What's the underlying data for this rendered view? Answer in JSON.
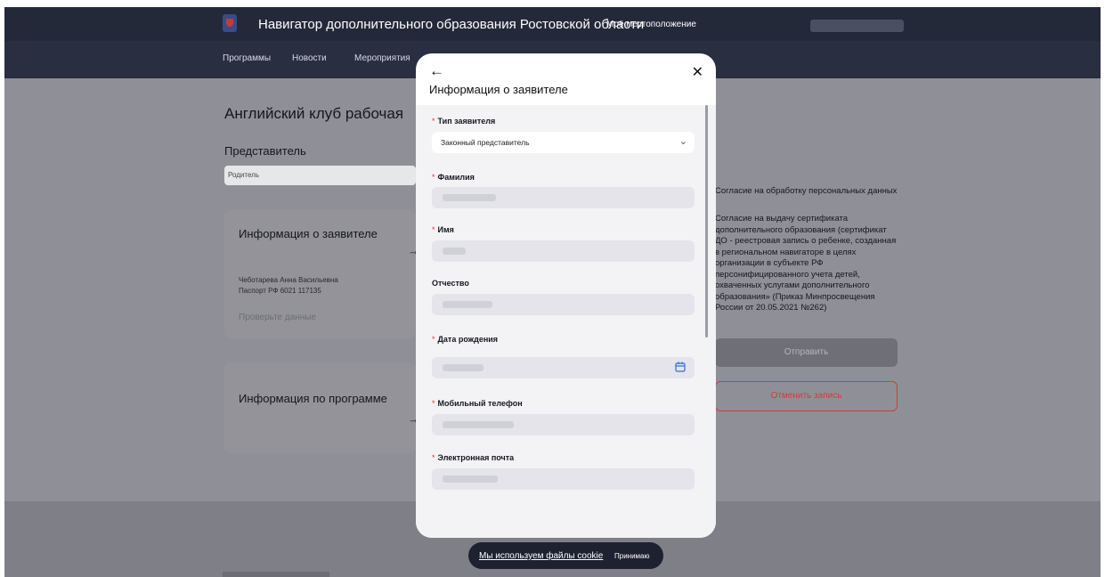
{
  "header": {
    "site_title": "Навигатор дополнительного образования Ростовской области",
    "location_label": "Моё местоположение",
    "nav": [
      "Программы",
      "Новости",
      "Мероприятия"
    ]
  },
  "page": {
    "program_title": "Английский клуб рабочая",
    "representative_label": "Представитель",
    "representative_value": "Родитель",
    "applicant_card": {
      "title": "Информация о заявителе",
      "name": "Чеботарева Анна Васильевна",
      "passport": "Паспорт РФ 6021 117135",
      "check_link": "Проверьте данные"
    },
    "program_card_title": "Информация по программе",
    "consents": [
      "Согласие на обработку персональных данных",
      "Согласие на выдачу сертификата дополнительного образования (сертификат ДО - реестровая запись о ребенке, созданная в региональном навигаторе в целях организации в субъекте РФ персонифицированного учета детей, охваченных услугами дополнительного образования» (Приказ Минпросвещения России от 20.05.2021 №262)"
    ],
    "send_button": "Отправить",
    "cancel_button": "Отменить запись"
  },
  "modal": {
    "title": "Информация о заявителе",
    "fields": [
      {
        "label": "Тип заявителя",
        "required": true,
        "value": "Законный представитель",
        "type": "select"
      },
      {
        "label": "Фамилия",
        "required": true,
        "value": "",
        "type": "text"
      },
      {
        "label": "Имя",
        "required": true,
        "value": "",
        "type": "text"
      },
      {
        "label": "Отчество",
        "required": false,
        "value": "",
        "type": "text"
      },
      {
        "label": "Дата рождения",
        "required": true,
        "value": "",
        "type": "date"
      },
      {
        "label": "Мобильный телефон",
        "required": true,
        "value": "",
        "type": "tel"
      },
      {
        "label": "Электронная почта",
        "required": true,
        "value": "",
        "type": "email"
      }
    ],
    "required_mark": "*",
    "back_icon": "arrow-left-icon",
    "close_icon": "close-icon"
  },
  "cookie": {
    "text": "Мы используем файлы cookie",
    "accept": "Принимаю"
  },
  "colors": {
    "header_bg": "#24293a",
    "required": "#e53935",
    "cancel": "#d23b3b",
    "calendar_icon": "#2f6fd6"
  }
}
